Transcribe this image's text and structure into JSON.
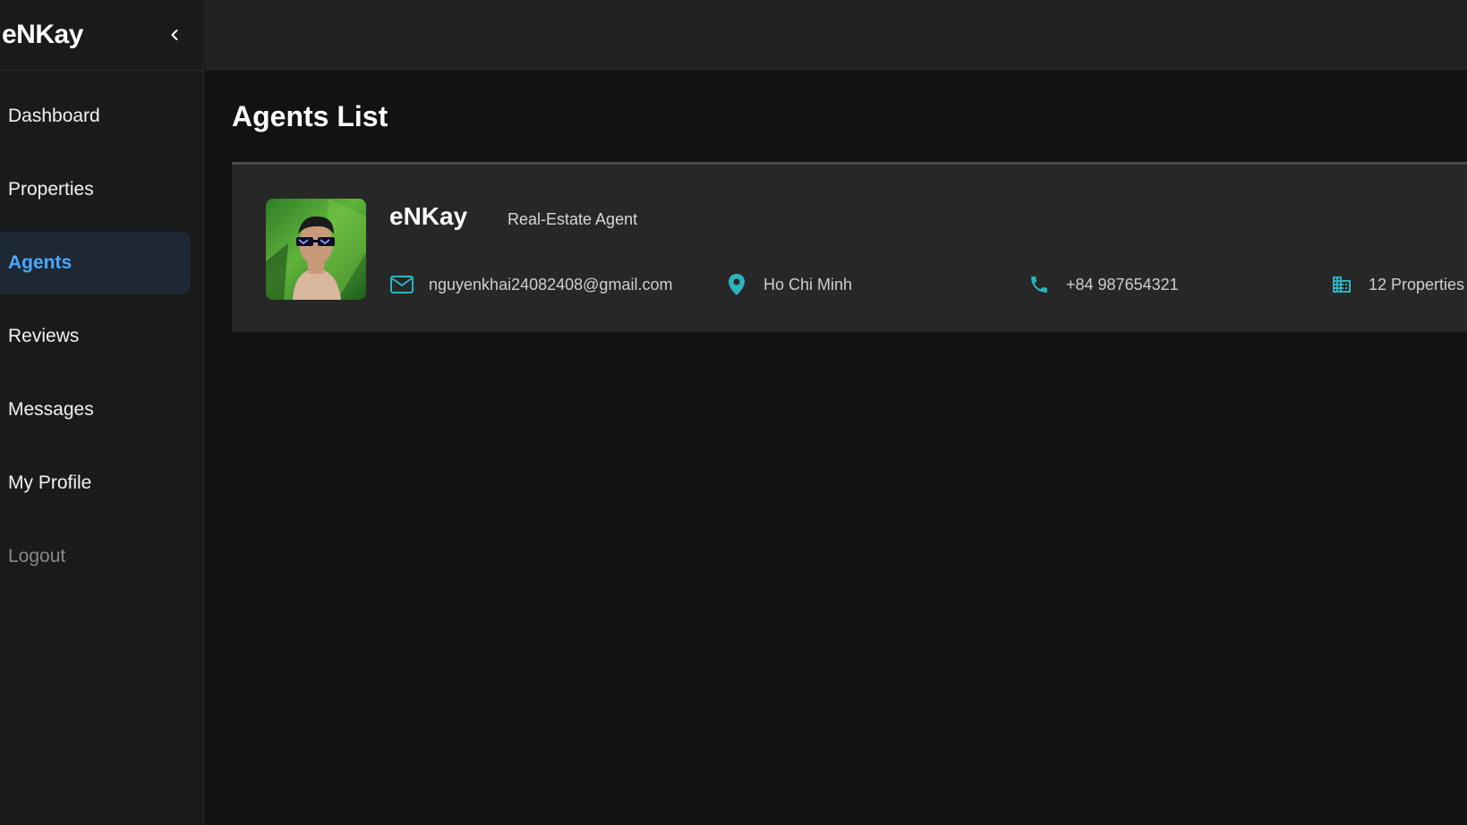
{
  "sidebar": {
    "brand": "eNKay",
    "items": [
      {
        "label": "Dashboard"
      },
      {
        "label": "Properties"
      },
      {
        "label": "Agents"
      },
      {
        "label": "Reviews"
      },
      {
        "label": "Messages"
      },
      {
        "label": "My Profile"
      },
      {
        "label": "Logout"
      }
    ],
    "active_item": "Agents"
  },
  "main": {
    "title": "Agents List",
    "agent": {
      "name": "eNKay",
      "role": "Real-Estate Agent",
      "email": "nguyenkhai24082408@gmail.com",
      "location": "Ho Chi Minh",
      "phone": "+84 987654321",
      "properties": "12 Properties"
    }
  },
  "icons": {
    "collapse": "chevron-left-icon",
    "email": "mail-icon",
    "location": "location-pin-icon",
    "phone": "phone-icon",
    "properties": "building-icon"
  },
  "colors": {
    "accent": "#4aa8ff",
    "icon": "#2bb3c0",
    "background": "#121212",
    "card": "#272727"
  }
}
